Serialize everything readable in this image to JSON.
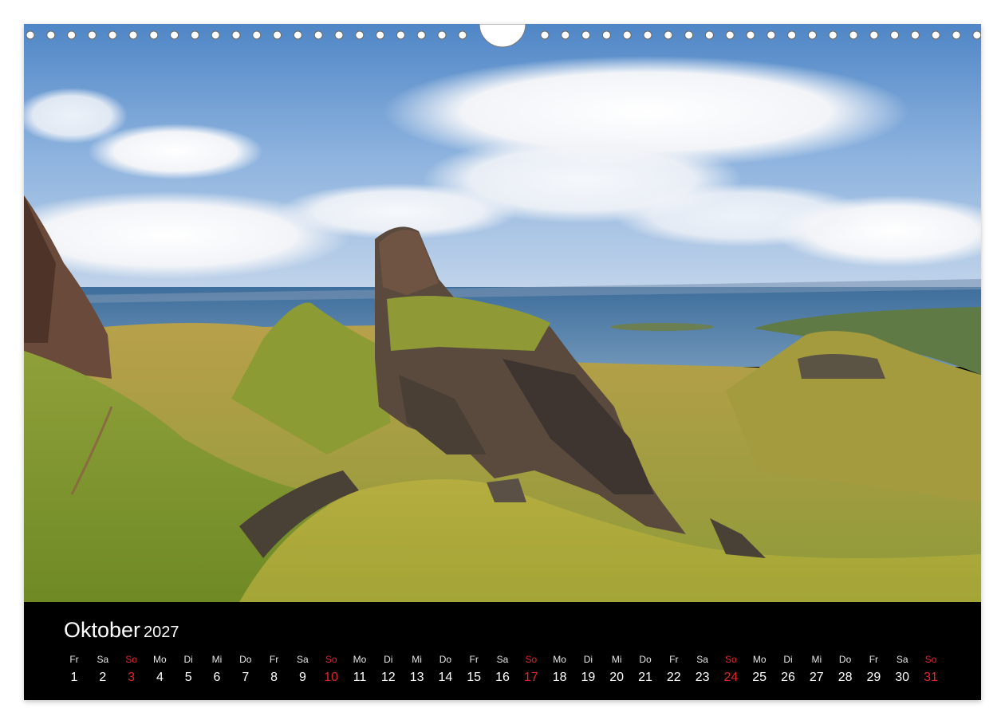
{
  "calendar": {
    "month": "Oktober",
    "year": "2027",
    "accent_color": "#e0262b",
    "days": [
      {
        "wd": "Fr",
        "num": "1",
        "sunday": false
      },
      {
        "wd": "Sa",
        "num": "2",
        "sunday": false
      },
      {
        "wd": "So",
        "num": "3",
        "sunday": true
      },
      {
        "wd": "Mo",
        "num": "4",
        "sunday": false
      },
      {
        "wd": "Di",
        "num": "5",
        "sunday": false
      },
      {
        "wd": "Mi",
        "num": "6",
        "sunday": false
      },
      {
        "wd": "Do",
        "num": "7",
        "sunday": false
      },
      {
        "wd": "Fr",
        "num": "8",
        "sunday": false
      },
      {
        "wd": "Sa",
        "num": "9",
        "sunday": false
      },
      {
        "wd": "So",
        "num": "10",
        "sunday": true
      },
      {
        "wd": "Mo",
        "num": "11",
        "sunday": false
      },
      {
        "wd": "Di",
        "num": "12",
        "sunday": false
      },
      {
        "wd": "Mi",
        "num": "13",
        "sunday": false
      },
      {
        "wd": "Do",
        "num": "14",
        "sunday": false
      },
      {
        "wd": "Fr",
        "num": "15",
        "sunday": false
      },
      {
        "wd": "Sa",
        "num": "16",
        "sunday": false
      },
      {
        "wd": "So",
        "num": "17",
        "sunday": true
      },
      {
        "wd": "Mo",
        "num": "18",
        "sunday": false
      },
      {
        "wd": "Di",
        "num": "19",
        "sunday": false
      },
      {
        "wd": "Mi",
        "num": "20",
        "sunday": false
      },
      {
        "wd": "Do",
        "num": "21",
        "sunday": false
      },
      {
        "wd": "Fr",
        "num": "22",
        "sunday": false
      },
      {
        "wd": "Sa",
        "num": "23",
        "sunday": false
      },
      {
        "wd": "So",
        "num": "24",
        "sunday": true
      },
      {
        "wd": "Mo",
        "num": "25",
        "sunday": false
      },
      {
        "wd": "Di",
        "num": "26",
        "sunday": false
      },
      {
        "wd": "Mi",
        "num": "27",
        "sunday": false
      },
      {
        "wd": "Do",
        "num": "28",
        "sunday": false
      },
      {
        "wd": "Fr",
        "num": "29",
        "sunday": false
      },
      {
        "wd": "Sa",
        "num": "30",
        "sunday": false
      },
      {
        "wd": "So",
        "num": "31",
        "sunday": true
      }
    ]
  }
}
